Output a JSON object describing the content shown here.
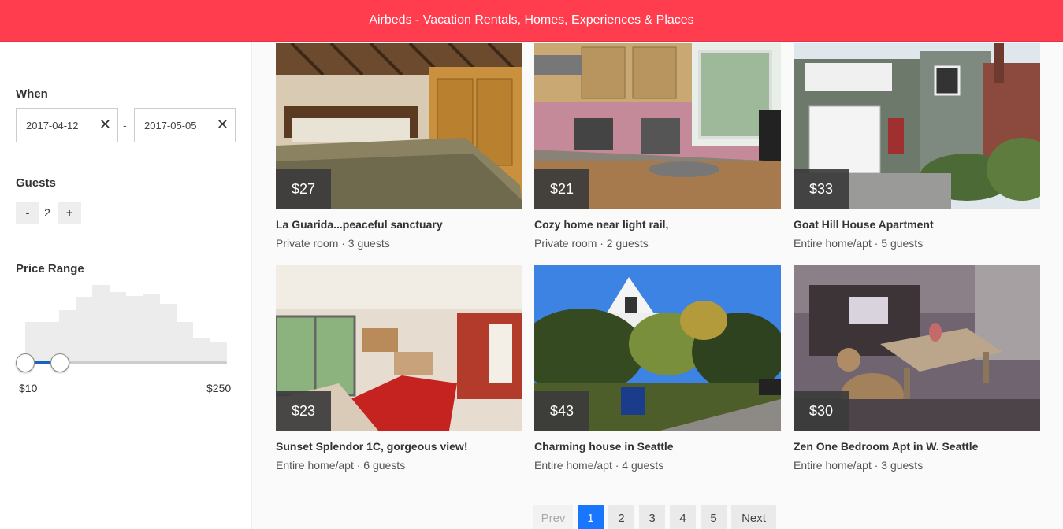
{
  "header": {
    "title": "Airbeds - Vacation Rentals, Homes, Experiences & Places"
  },
  "filters": {
    "when_label": "When",
    "start_date": "2017-04-12",
    "end_date": "2017-05-05",
    "separator": "-",
    "guests_label": "Guests",
    "guests_minus": "-",
    "guests_plus": "+",
    "guests_count": "2",
    "price_label": "Price Range",
    "price_min": "$10",
    "price_max": "$250",
    "histogram": [
      0.52,
      0.52,
      0.66,
      0.83,
      0.97,
      0.88,
      0.84,
      0.86,
      0.74,
      0.52,
      0.33,
      0.27
    ],
    "slider_low_fraction": 0.0,
    "slider_high_fraction": 0.17
  },
  "listings": [
    {
      "price": "$27",
      "title": "La Guarida...peaceful sanctuary",
      "meta": "Private room · 3 guests"
    },
    {
      "price": "$21",
      "title": "Cozy home near light rail,",
      "meta": "Private room · 2 guests"
    },
    {
      "price": "$33",
      "title": "Goat Hill House Apartment",
      "meta": "Entire home/apt · 5 guests"
    },
    {
      "price": "$23",
      "title": "Sunset Splendor 1C, gorgeous view!",
      "meta": "Entire home/apt · 6 guests"
    },
    {
      "price": "$43",
      "title": "Charming house in Seattle",
      "meta": "Entire home/apt · 4 guests"
    },
    {
      "price": "$30",
      "title": "Zen One Bedroom Apt in W. Seattle",
      "meta": "Entire home/apt · 3 guests"
    }
  ],
  "pagination": {
    "prev": "Prev",
    "pages": [
      "1",
      "2",
      "3",
      "4",
      "5"
    ],
    "current": "1",
    "next": "Next"
  },
  "colors": {
    "accent": "#ff3d4f",
    "active_page": "#1976ff",
    "slider": "#1565c0"
  }
}
